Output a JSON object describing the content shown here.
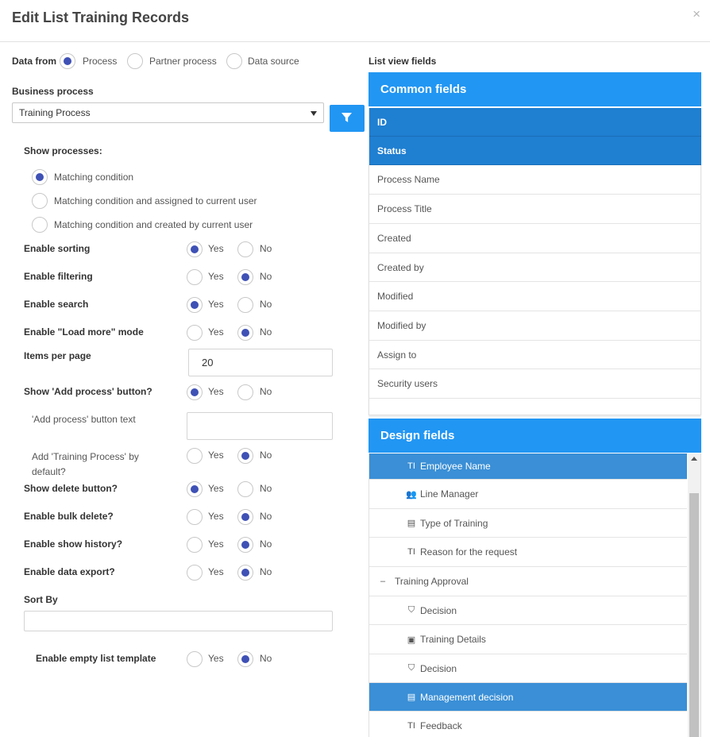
{
  "dialog": {
    "title": "Edit List Training Records",
    "close_glyph": "×"
  },
  "data_from": {
    "label": "Data from",
    "options": [
      "Process",
      "Partner process",
      "Data source"
    ],
    "selected": "Process"
  },
  "business_process": {
    "label": "Business process",
    "value": "Training Process"
  },
  "show_processes": {
    "label": "Show processes:",
    "options": [
      "Matching condition",
      "Matching condition and assigned to current user",
      "Matching condition and created by current user"
    ],
    "selected": "Matching condition"
  },
  "yes_label": "Yes",
  "no_label": "No",
  "settings": [
    {
      "label": "Enable sorting",
      "value": "Yes"
    },
    {
      "label": "Enable filtering",
      "value": "No"
    },
    {
      "label": "Enable search",
      "value": "Yes"
    },
    {
      "label": "Enable \"Load more\" mode",
      "value": "No"
    },
    {
      "label": "Show 'Add process' button?",
      "value": "Yes"
    },
    {
      "label": "Add 'Training Process' by default?",
      "value": "No"
    },
    {
      "label": "Show delete button?",
      "value": "Yes"
    },
    {
      "label": "Enable bulk delete?",
      "value": "No"
    },
    {
      "label": "Enable show history?",
      "value": "No"
    },
    {
      "label": "Enable data export?",
      "value": "No"
    },
    {
      "label": "Enable empty list template",
      "value": "No"
    }
  ],
  "items_per_page": {
    "label": "Items per page",
    "value": "20"
  },
  "add_process_text": {
    "label": "'Add process' button text",
    "value": ""
  },
  "sort_by": {
    "label": "Sort By",
    "value": ""
  },
  "list_view_fields": {
    "label": "List view fields",
    "common_title": "Common fields",
    "common_fields": [
      "ID",
      "Status",
      "Process Name",
      "Process Title",
      "Created",
      "Created by",
      "Modified",
      "Modified by",
      "Assign to",
      "Security users"
    ],
    "common_selected": [
      "ID",
      "Status"
    ],
    "design_title": "Design fields",
    "design_fields": [
      {
        "label": "Employee Name",
        "icon": "text-field-icon",
        "glyph": "TI",
        "selected": true
      },
      {
        "label": "Line Manager",
        "icon": "users-icon",
        "glyph": "👥",
        "selected": false
      },
      {
        "label": "Type of Training",
        "icon": "list-icon",
        "glyph": "▤",
        "selected": false
      },
      {
        "label": "Reason for the request",
        "icon": "text-field-icon",
        "glyph": "TI",
        "selected": false
      },
      {
        "label": "Training Approval",
        "icon": "collapse-icon",
        "glyph": "–",
        "selected": false,
        "group": true
      },
      {
        "label": "Decision",
        "icon": "html5-icon",
        "glyph": "⛉",
        "selected": false
      },
      {
        "label": "Training Details",
        "icon": "image-icon",
        "glyph": "▣",
        "selected": false
      },
      {
        "label": "Decision",
        "icon": "html5-icon",
        "glyph": "⛉",
        "selected": false
      },
      {
        "label": "Management decision",
        "icon": "list-icon",
        "glyph": "▤",
        "selected": true
      },
      {
        "label": "Feedback",
        "icon": "text-field-icon",
        "glyph": "TI",
        "selected": false
      }
    ]
  },
  "colors": {
    "accent": "#2196f3",
    "selected_row": "#1f7fd1",
    "radio": "#3f51b5"
  }
}
